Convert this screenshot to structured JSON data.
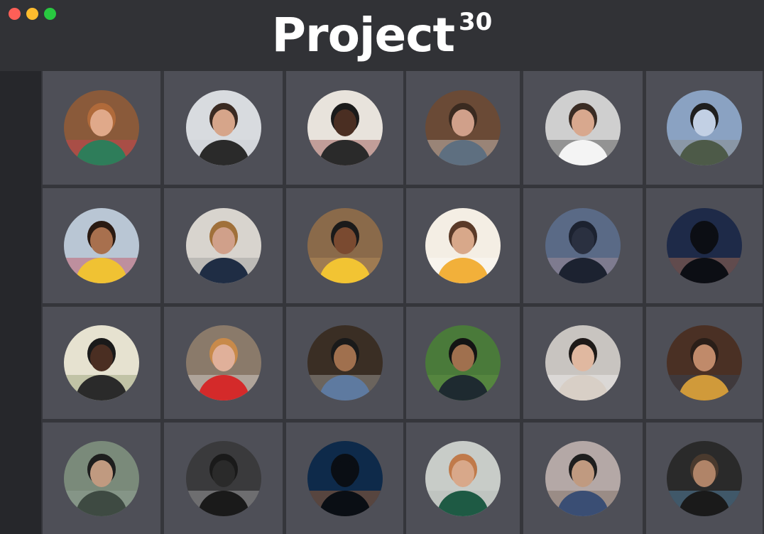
{
  "window": {
    "title": "Project",
    "title_superscript": "30",
    "controls": [
      "close-button",
      "minimize-button",
      "maximize-button"
    ]
  },
  "grid": {
    "columns": 6,
    "rows": 4,
    "items": [
      {
        "name": "avatar-woman-red-folder",
        "bg": "#8a5a3a",
        "body": "#2e7d5a",
        "skin": "#e0a98a",
        "hair": "#b06a3a",
        "accent": "#e23a5e"
      },
      {
        "name": "avatar-woman-laptop",
        "bg": "#d8dbdf",
        "body": "#2a2a2a",
        "skin": "#d6a58a",
        "hair": "#3a2a22",
        "accent": "#c9ccd1"
      },
      {
        "name": "avatar-man-headphones-writing",
        "bg": "#e8e3dc",
        "body": "#2a2a2a",
        "skin": "#4a2e22",
        "hair": "#1a1a1a",
        "accent": "#7a1e1e"
      },
      {
        "name": "avatar-man-reading-library",
        "bg": "#6a4a36",
        "body": "#5e6f80",
        "skin": "#d0a08a",
        "hair": "#3a2a20",
        "accent": "#f2f2f2"
      },
      {
        "name": "avatar-man-glasses",
        "bg": "#cfcfcf",
        "body": "#f4f4f4",
        "skin": "#d8a88e",
        "hair": "#3a2c24",
        "accent": "#222222"
      },
      {
        "name": "avatar-hiker-mountains",
        "bg": "#8aa2c2",
        "body": "#4d5a48",
        "skin": "#c2d0e4",
        "hair": "#1e1e1e",
        "accent": "#8a8574"
      },
      {
        "name": "avatar-woman-yellow-top",
        "bg": "#b9c6d4",
        "body": "#f0c233",
        "skin": "#a8704e",
        "hair": "#2a1a12",
        "accent": "#c8283a"
      },
      {
        "name": "avatar-man-sitting-stairs",
        "bg": "#d8d4ce",
        "body": "#1f2d44",
        "skin": "#d0a08a",
        "hair": "#a0703a",
        "accent": "#8a8a8a"
      },
      {
        "name": "avatar-boy-yellow-shirt",
        "bg": "#8a6a4a",
        "body": "#f2c433",
        "skin": "#7a4a30",
        "hair": "#1a1a1a",
        "accent": "#c79a62"
      },
      {
        "name": "avatar-girl-studying",
        "bg": "#f4eee4",
        "body": "#f2b03a",
        "skin": "#d8a88a",
        "hair": "#5a3a28",
        "accent": "#ffffff"
      },
      {
        "name": "avatar-silhouette-lake",
        "bg": "#5a6a86",
        "body": "#1c2230",
        "skin": "#2a3040",
        "hair": "#1c2230",
        "accent": "#c49aa0"
      },
      {
        "name": "avatar-silhouette-sparkler",
        "bg": "#1e2a48",
        "body": "#0c0e14",
        "skin": "#0c0e14",
        "hair": "#0c0e14",
        "accent": "#e08a5a"
      },
      {
        "name": "avatar-man-window",
        "bg": "#e6e2d0",
        "body": "#2a2a2a",
        "skin": "#4a2e22",
        "hair": "#1a1a1a",
        "accent": "#7a8a5a"
      },
      {
        "name": "avatar-woman-red-blazer",
        "bg": "#8a7a6a",
        "body": "#d42a2a",
        "skin": "#e0b09a",
        "hair": "#c88a4a",
        "accent": "#f4f4f4"
      },
      {
        "name": "avatar-man-laptop-chair",
        "bg": "#3a2e24",
        "body": "#5e7aa0",
        "skin": "#a0704e",
        "hair": "#1a1a1a",
        "accent": "#c8c8c8"
      },
      {
        "name": "avatar-boy-smiling",
        "bg": "#4a7a3a",
        "body": "#1e2a30",
        "skin": "#a0704e",
        "hair": "#141414",
        "accent": "#6a9a4a"
      },
      {
        "name": "avatar-man-earphones",
        "bg": "#c8c4c0",
        "body": "#d8cfc6",
        "skin": "#e0b8a0",
        "hair": "#1e1a18",
        "accent": "#ffffff"
      },
      {
        "name": "avatar-man-mustard-jacket",
        "bg": "#4a3024",
        "body": "#d09a3a",
        "skin": "#c08a6a",
        "hair": "#2a1e18",
        "accent": "#2a4a6a"
      },
      {
        "name": "avatar-man-back-view",
        "bg": "#7a8a7a",
        "body": "#3e4a42",
        "skin": "#c09a80",
        "hair": "#1e1e1e",
        "accent": "#9aa8a0"
      },
      {
        "name": "avatar-figure-corridor",
        "bg": "#3a3a3c",
        "body": "#1a1a1a",
        "skin": "#2a2a2a",
        "hair": "#1a1a1a",
        "accent": "#d0d0d0"
      },
      {
        "name": "avatar-silhouette-sunset",
        "bg": "#0e2a4a",
        "body": "#0a0e14",
        "skin": "#0a0e14",
        "hair": "#0a0e14",
        "accent": "#e0782a"
      },
      {
        "name": "avatar-woman-green-coat",
        "bg": "#c8ccc8",
        "body": "#1e5a44",
        "skin": "#d8a88a",
        "hair": "#c07a4a",
        "accent": "#aeb4b2"
      },
      {
        "name": "avatar-man-sitting-dusk",
        "bg": "#b4a8a6",
        "body": "#3a4e74",
        "skin": "#c09a80",
        "hair": "#1e1e1e",
        "accent": "#6a5a4a"
      },
      {
        "name": "avatar-man-hood-beard",
        "bg": "#2a2a2a",
        "body": "#1a1a1a",
        "skin": "#b08468",
        "hair": "#4a3a2e",
        "accent": "#6ab0e0"
      }
    ]
  }
}
